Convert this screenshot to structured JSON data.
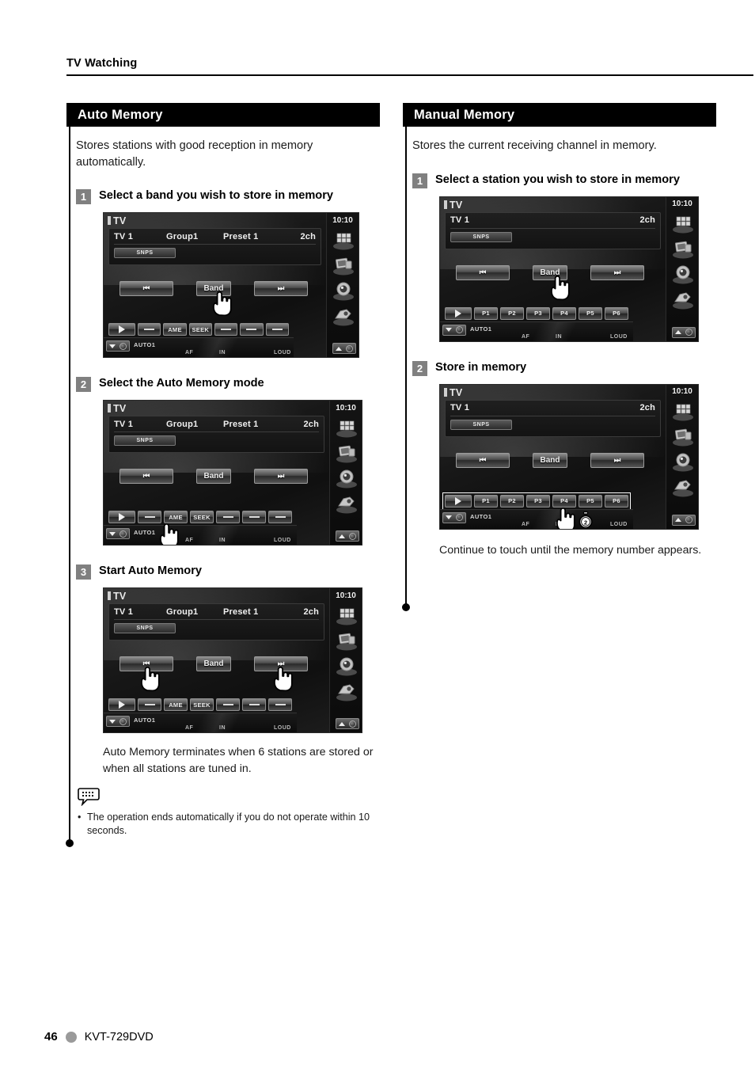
{
  "running_head": "TV Watching",
  "footer": {
    "page_number": "46",
    "model": "KVT-729DVD",
    "dot_color": "#9a9a9a"
  },
  "columns": {
    "left": {
      "section_title": "Auto Memory",
      "intro": "Stores stations with good reception in memory automatically.",
      "steps": [
        {
          "num": "1",
          "title": "Select a band you wish to store in memory"
        },
        {
          "num": "2",
          "title": "Select the Auto Memory mode"
        },
        {
          "num": "3",
          "title": "Start Auto Memory"
        }
      ],
      "after_note": "Auto Memory terminates when 6 stations are stored or when all stations are tuned in.",
      "bullets": [
        {
          "marker": "•",
          "text": "The operation ends automatically if you do not operate within 10 seconds."
        }
      ]
    },
    "right": {
      "section_title": "Manual Memory",
      "intro": "Stores the current receiving channel in memory.",
      "steps": [
        {
          "num": "1",
          "title": "Select a station you wish to store in memory"
        },
        {
          "num": "2",
          "title": "Store in memory"
        }
      ],
      "after_note": "Continue to touch until the memory number appears."
    }
  },
  "tv_screens": {
    "left_step1": {
      "source_label": "TV",
      "clock": "10:10",
      "band": "TV 1",
      "group": "Group1",
      "preset": "Preset 1",
      "channel": "2ch",
      "snps": "SNPS",
      "transport": {
        "prev": "⏮",
        "band": "Band",
        "next": "⏭"
      },
      "function_buttons": [
        "▶",
        "—",
        "AME",
        "SEEK",
        "—",
        "—",
        "—"
      ],
      "status": {
        "auto": "AUTO1",
        "af": "AF",
        "in": "IN",
        "loud": "LOUD"
      },
      "hands": [
        "band-button"
      ]
    },
    "left_step2": {
      "source_label": "TV",
      "clock": "10:10",
      "band": "TV 1",
      "group": "Group1",
      "preset": "Preset 1",
      "channel": "2ch",
      "snps": "SNPS",
      "transport": {
        "prev": "⏮",
        "band": "Band",
        "next": "⏭"
      },
      "function_buttons": [
        "▶",
        "—",
        "AME",
        "SEEK",
        "—",
        "—",
        "—"
      ],
      "status": {
        "auto": "AUTO1",
        "af": "AF",
        "in": "IN",
        "loud": "LOUD"
      },
      "hands": [
        "ame-button"
      ]
    },
    "left_step3": {
      "source_label": "TV",
      "clock": "10:10",
      "band": "TV 1",
      "group": "Group1",
      "preset": "Preset 1",
      "channel": "2ch",
      "snps": "SNPS",
      "transport": {
        "prev": "⏮",
        "band": "Band",
        "next": "⏭"
      },
      "function_buttons": [
        "▶",
        "—",
        "AME",
        "SEEK",
        "—",
        "—",
        "—"
      ],
      "status": {
        "auto": "AUTO1",
        "af": "AF",
        "in": "IN",
        "loud": "LOUD"
      },
      "hands": [
        "prev-button",
        "next-button"
      ]
    },
    "right_step1": {
      "source_label": "TV",
      "clock": "10:10",
      "band": "TV 1",
      "group": "",
      "preset": "",
      "channel": "2ch",
      "snps": "SNPS",
      "transport": {
        "prev": "⏮",
        "band": "Band",
        "next": "⏭"
      },
      "function_buttons": [
        "▶",
        "P1",
        "P2",
        "P3",
        "P4",
        "P5",
        "P6"
      ],
      "status": {
        "auto": "AUTO1",
        "af": "AF",
        "in": "IN",
        "loud": "LOUD"
      },
      "hands": [
        "band-button"
      ]
    },
    "right_step2": {
      "source_label": "TV",
      "clock": "10:10",
      "band": "TV 1",
      "group": "",
      "preset": "",
      "channel": "2ch",
      "snps": "SNPS",
      "transport": {
        "prev": "⏮",
        "band": "Band",
        "next": "⏭"
      },
      "function_buttons": [
        "▶",
        "P1",
        "P2",
        "P3",
        "P4",
        "P5",
        "P6"
      ],
      "status": {
        "auto": "AUTO1",
        "af": "AF",
        "in": "IN",
        "loud": "LOUD"
      },
      "hands": [
        "preset-row"
      ],
      "hold_seconds_badge": "2",
      "preset_row_highlighted": true
    }
  },
  "icons": {
    "rail": [
      "menu-grid-icon",
      "display-setup-icon",
      "speaker-icon",
      "av-in-icon"
    ],
    "note_bubble": "note-bubble-icon",
    "hand": "pointing-hand-icon",
    "stopwatch": "stopwatch-2s-icon"
  }
}
